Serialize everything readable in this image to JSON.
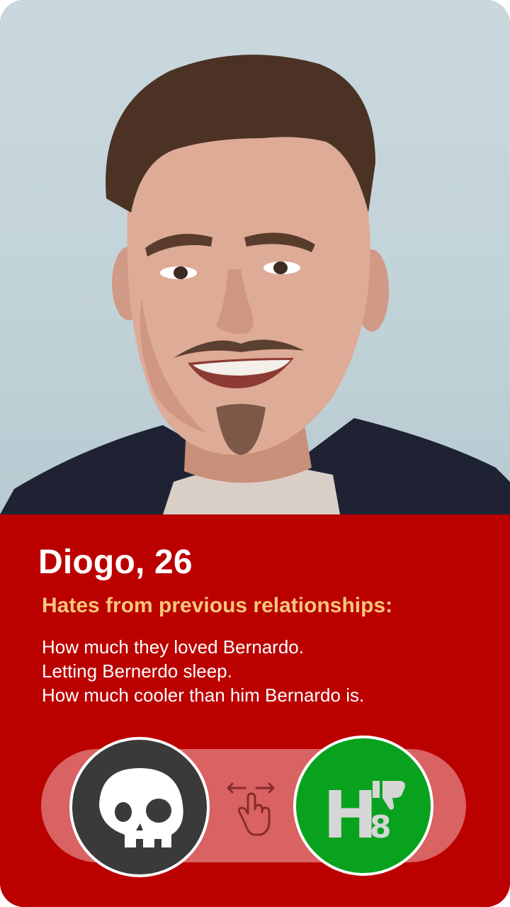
{
  "profile": {
    "name_age": "Diogo, 26",
    "photo_icon": "profile-photo",
    "hates_heading": "Hates from previous relationships:",
    "hates": [
      "How much they loved Bernardo.",
      "Letting Bernerdo sleep.",
      "How much cooler than him Bernardo is."
    ]
  },
  "actions": {
    "dislike_icon": "skull-icon",
    "swipe_hint_icon": "swipe-hand-icon",
    "hate_icon": "h8-thumbs-down-icon",
    "hate_logo_letter": "H",
    "hate_logo_digit": "8"
  },
  "colors": {
    "card_background": "#bb0000",
    "heading_accent": "#f7c77a",
    "dislike_button": "#3a3a3a",
    "hate_button": "#09a21f",
    "swipe_track": "#d96262"
  }
}
